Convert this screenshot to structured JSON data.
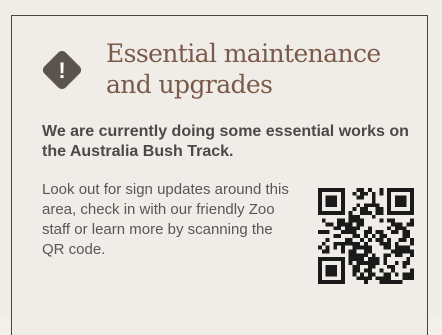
{
  "notice": {
    "icon": "warning-icon",
    "icon_symbol": "!",
    "title": "Essential maintenance and upgrades",
    "lead": "We are currently doing some essential works on the Australia Bush Track.",
    "body": "Look out for sign updates around this area, check in with our friendly Zoo staff or learn more by scanning the QR code.",
    "qr_icon": "qr-code-icon",
    "colors": {
      "background": "#f0ece7",
      "border": "#4a4540",
      "icon_fill": "#5a534e",
      "title": "#7a5a4a",
      "lead_text": "#4e4946",
      "body_text": "#5b5654",
      "qr": "#1a1a1a"
    }
  }
}
